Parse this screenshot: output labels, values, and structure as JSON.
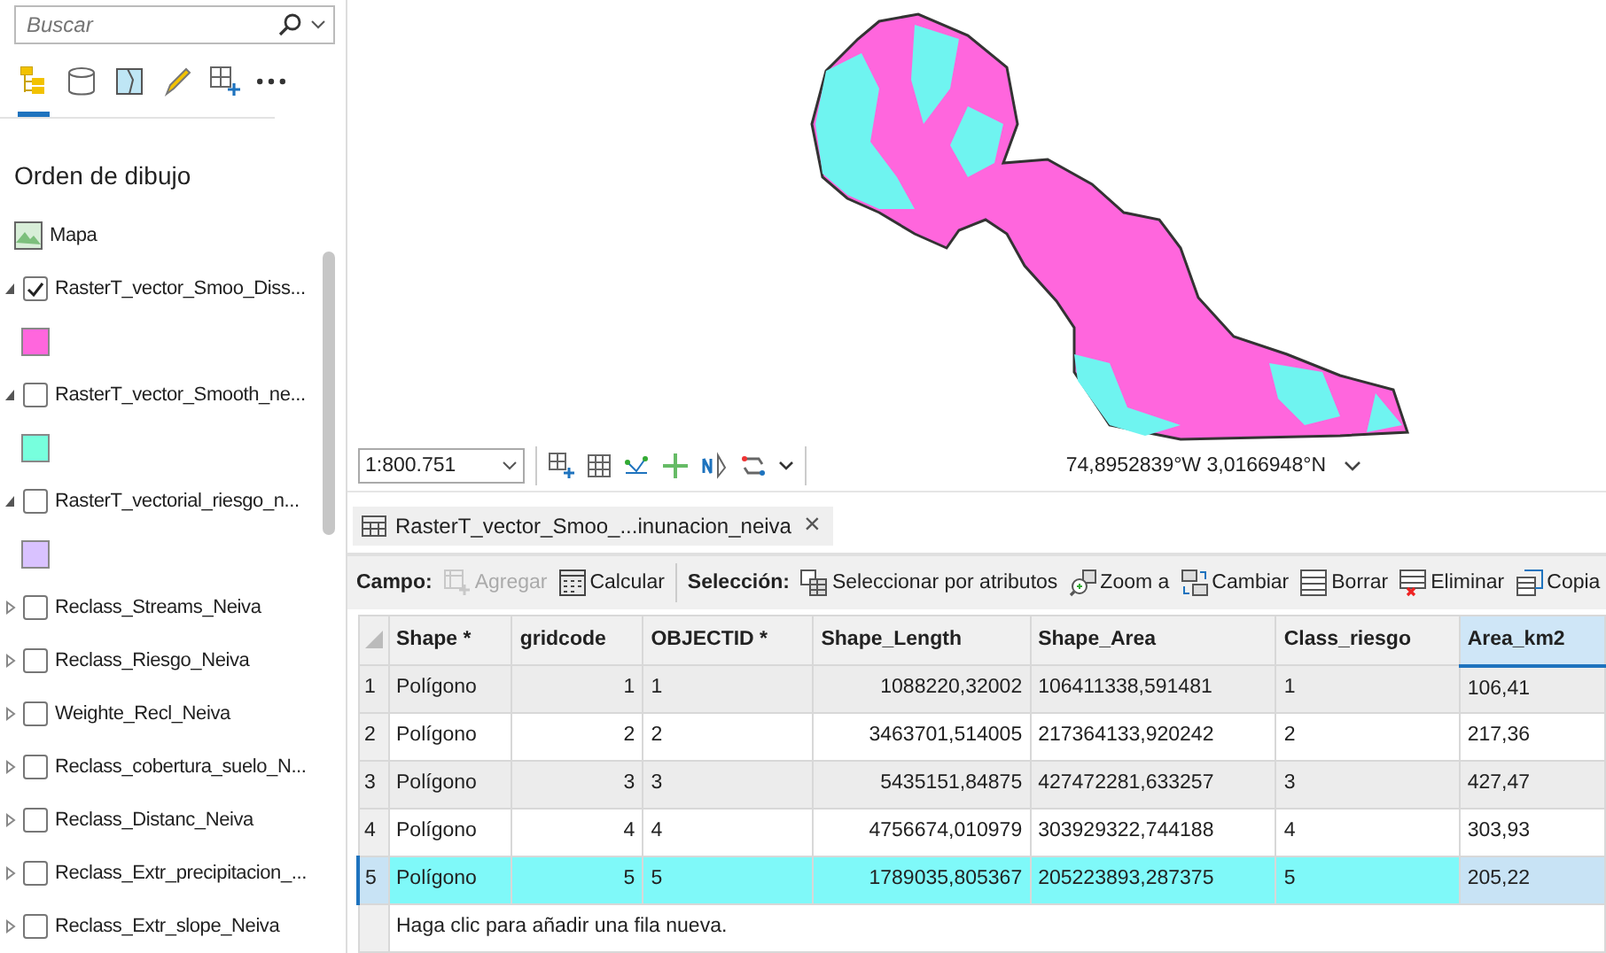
{
  "search": {
    "placeholder": "Buscar"
  },
  "panel_tabs": [
    {
      "kind": "tree",
      "selected": true
    },
    {
      "kind": "db",
      "selected": false
    },
    {
      "kind": "map",
      "selected": false
    },
    {
      "kind": "pencil",
      "selected": false
    },
    {
      "kind": "grid",
      "selected": false
    },
    {
      "kind": "more",
      "selected": false
    }
  ],
  "heading": "Orden de dibujo",
  "layers": [
    {
      "kind": "map",
      "label": "Mapa"
    },
    {
      "kind": "layer",
      "label": "RasterT_vector_Smoo_Diss...",
      "checked": true,
      "expanded": true,
      "color": "#ff66dd"
    },
    {
      "kind": "layer",
      "label": "RasterT_vector_Smooth_ne...",
      "checked": false,
      "expanded": true,
      "color": "#77ffdd"
    },
    {
      "kind": "layer",
      "label": "RasterT_vectorial_riesgo_n...",
      "checked": false,
      "expanded": true,
      "color": "#d9c2ff"
    },
    {
      "kind": "layer",
      "label": "Reclass_Streams_Neiva",
      "checked": false,
      "expanded": false
    },
    {
      "kind": "layer",
      "label": "Reclass_Riesgo_Neiva",
      "checked": false,
      "expanded": false
    },
    {
      "kind": "layer",
      "label": "Weighte_Recl_Neiva",
      "checked": false,
      "expanded": false
    },
    {
      "kind": "layer",
      "label": "Reclass_cobertura_suelo_N...",
      "checked": false,
      "expanded": false
    },
    {
      "kind": "layer",
      "label": "Reclass_Distanc_Neiva",
      "checked": false,
      "expanded": false
    },
    {
      "kind": "layer",
      "label": "Reclass_Extr_precipitacion_...",
      "checked": false,
      "expanded": false
    },
    {
      "kind": "layer",
      "label": "Reclass_Extr_slope_Neiva",
      "checked": false,
      "expanded": false
    }
  ],
  "status_bar": {
    "scale": "1:800.751",
    "coordinates": "74,8952839°W 3,0166948°N"
  },
  "table_tab": {
    "label": "RasterT_vector_Smoo_...inunacion_neiva",
    "close": "×"
  },
  "toolbar": [
    {
      "kind": "label",
      "label": "Campo:"
    },
    {
      "kind": "button",
      "label": "Agregar",
      "disabled": true
    },
    {
      "kind": "button",
      "label": "Calcular",
      "disabled": false
    },
    {
      "kind": "sep"
    },
    {
      "kind": "label",
      "label": "Selección:"
    },
    {
      "kind": "button",
      "label": "Seleccionar por atributos",
      "disabled": false
    },
    {
      "kind": "button",
      "label": "Zoom a",
      "disabled": false
    },
    {
      "kind": "button",
      "label": "Cambiar",
      "disabled": false
    },
    {
      "kind": "button",
      "label": "Borrar",
      "disabled": false
    },
    {
      "kind": "button",
      "label": "Eliminar",
      "disabled": false
    },
    {
      "kind": "button",
      "label": "Copia",
      "disabled": false
    }
  ],
  "table": {
    "columns": [
      {
        "label": "Shape *",
        "selected": false
      },
      {
        "label": "gridcode",
        "selected": false
      },
      {
        "label": "OBJECTID *",
        "selected": false
      },
      {
        "label": "Shape_Length",
        "selected": false
      },
      {
        "label": "Shape_Area",
        "selected": false
      },
      {
        "label": "Class_riesgo",
        "selected": false
      },
      {
        "label": "Area_km2",
        "selected": true
      }
    ],
    "rows": [
      {
        "num": "1",
        "selected": false,
        "cells": [
          "Polígono",
          "1",
          "1",
          "1088220,32002",
          "106411338,591481",
          "1",
          "106,41"
        ]
      },
      {
        "num": "2",
        "selected": false,
        "cells": [
          "Polígono",
          "2",
          "2",
          "3463701,514005",
          "217364133,920242",
          "2",
          "217,36"
        ]
      },
      {
        "num": "3",
        "selected": false,
        "cells": [
          "Polígono",
          "3",
          "3",
          "5435151,84875",
          "427472281,633257",
          "3",
          "427,47"
        ]
      },
      {
        "num": "4",
        "selected": false,
        "cells": [
          "Polígono",
          "4",
          "4",
          "4756674,010979",
          "303929322,744188",
          "4",
          "303,93"
        ]
      },
      {
        "num": "5",
        "selected": true,
        "cells": [
          "Polígono",
          "5",
          "5",
          "1789035,805367",
          "205223893,287375",
          "5",
          "205,22"
        ]
      }
    ],
    "new_row": "Haga clic para añadir una fila nueva."
  }
}
